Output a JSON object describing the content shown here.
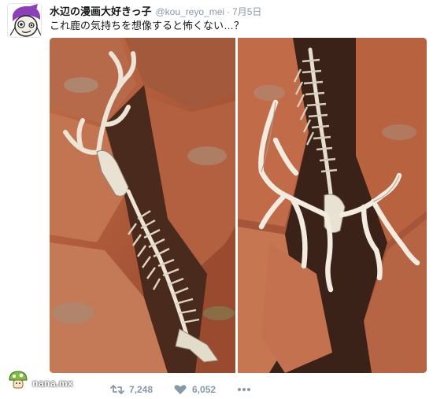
{
  "tweet": {
    "display_name": "水辺の漫画大好きっ子",
    "handle": "@kou_reyo_mei",
    "separator": "·",
    "date": "7月5日",
    "text": "これ鹿の気持ちを想像すると怖くない…？",
    "media": [
      {
        "icon": "photo-deer-skeleton-left"
      },
      {
        "icon": "photo-deer-skeleton-right"
      }
    ]
  },
  "actions": {
    "reply": {
      "icon": "reply-icon"
    },
    "retweet": {
      "icon": "retweet-icon",
      "count": "7,248"
    },
    "like": {
      "icon": "heart-icon",
      "count": "6,052"
    },
    "more": {
      "icon": "more-dots-icon"
    }
  },
  "watermark": {
    "text": "nana.mx",
    "logo": "mushroom-logo-icon"
  },
  "colors": {
    "secondary_text": "#8899a6",
    "rock": "#b8603e",
    "bone": "#efe9dc"
  }
}
